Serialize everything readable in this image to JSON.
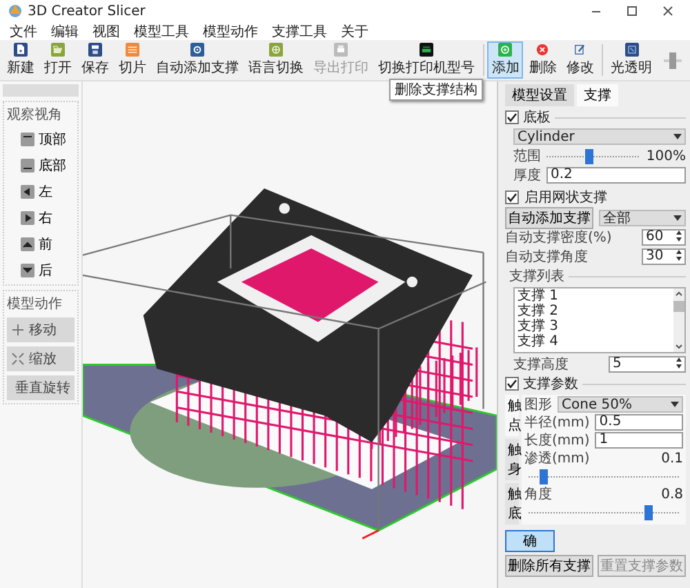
{
  "window": {
    "title": "3D Creator Slicer"
  },
  "menu": [
    "文件",
    "编辑",
    "视图",
    "模型工具",
    "模型动作",
    "支撑工具",
    "关于"
  ],
  "toolbar": {
    "buttons": [
      {
        "label": "新建",
        "kind": "new",
        "selected": false,
        "disabled": false
      },
      {
        "label": "打开",
        "kind": "open",
        "selected": false,
        "disabled": false
      },
      {
        "label": "保存",
        "kind": "save",
        "selected": false,
        "disabled": false
      },
      {
        "label": "切片",
        "kind": "slice",
        "selected": false,
        "disabled": false
      },
      {
        "label": "自动添加支撑",
        "kind": "auto",
        "selected": false,
        "disabled": false
      },
      {
        "label": "语言切换",
        "kind": "language",
        "selected": false,
        "disabled": false
      },
      {
        "label": "导出打印",
        "kind": "export",
        "selected": false,
        "disabled": true
      },
      {
        "label": "切换打印机型号",
        "kind": "printer",
        "selected": false,
        "disabled": false
      },
      {
        "label": "添加",
        "kind": "add",
        "selected": true,
        "disabled": false
      },
      {
        "label": "删除",
        "kind": "delete",
        "selected": false,
        "disabled": false
      },
      {
        "label": "修改",
        "kind": "edit",
        "selected": false,
        "disabled": false
      },
      {
        "label": "光透明",
        "kind": "transparent",
        "selected": false,
        "disabled": false
      }
    ],
    "slider": {
      "level": 0.55
    }
  },
  "tooltip": "删除支撑结构",
  "left_panel": {
    "view_group": {
      "title": "观察视角",
      "items": [
        {
          "label": "顶部",
          "kind": "top"
        },
        {
          "label": "底部",
          "kind": "bottom"
        },
        {
          "label": "左",
          "kind": "left"
        },
        {
          "label": "右",
          "kind": "right"
        },
        {
          "label": "前",
          "kind": "front"
        },
        {
          "label": "后",
          "kind": "back"
        }
      ]
    },
    "action_group": {
      "title": "模型动作",
      "items": [
        {
          "label": "移动",
          "kind": "move"
        },
        {
          "label": "缩放",
          "kind": "scale"
        },
        {
          "label": "垂直旋转",
          "kind": "rotate"
        }
      ]
    }
  },
  "support_panel": {
    "tabs": [
      {
        "label": "模型设置",
        "selected": false
      },
      {
        "label": "支撑",
        "selected": true
      }
    ],
    "base": {
      "label": "底板",
      "checked": true,
      "shape": "Cylinder",
      "range": {
        "label": "范围",
        "level": 0.45,
        "reading": "100%"
      },
      "thickness": {
        "label": "厚度",
        "value": "0.2"
      }
    },
    "mesh": {
      "label": "启用网状支撑",
      "checked": true
    },
    "auto": {
      "button": "自动添加支撑",
      "scope": "全部",
      "density": {
        "label": "自动支撑密度(%)",
        "value": "60"
      },
      "angle": {
        "label": "自动支撑角度",
        "value": "30"
      }
    },
    "list": {
      "title": "支撑列表",
      "items": [
        "支撑 1",
        "支撑 2",
        "支撑 3",
        "支撑 4"
      ]
    },
    "height": {
      "label": "支撑高度",
      "value": "5"
    },
    "params": {
      "label": "支撑参数",
      "checked": true,
      "side_tabs": [
        {
          "label": "触点",
          "selected": true
        },
        {
          "label": "触身",
          "selected": false
        },
        {
          "label": "触底",
          "selected": false
        }
      ],
      "shape": {
        "label": "图形",
        "value": "Cone 50%"
      },
      "radius": {
        "label": "半径(mm)",
        "value": "0.5"
      },
      "length": {
        "label": "长度(mm)",
        "value": "1"
      },
      "depth": {
        "label": "渗透(mm)",
        "reading": "0.1",
        "level": 0.1
      },
      "angle": {
        "label": "角度",
        "reading": "0.8",
        "level": 0.8
      }
    },
    "buttons": [
      {
        "label": "确",
        "selected": true,
        "disabled": false
      },
      {
        "label": "删除所有支撑",
        "selected": false,
        "disabled": false
      },
      {
        "label": "重置支撑参数",
        "selected": false,
        "disabled": true
      }
    ]
  }
}
